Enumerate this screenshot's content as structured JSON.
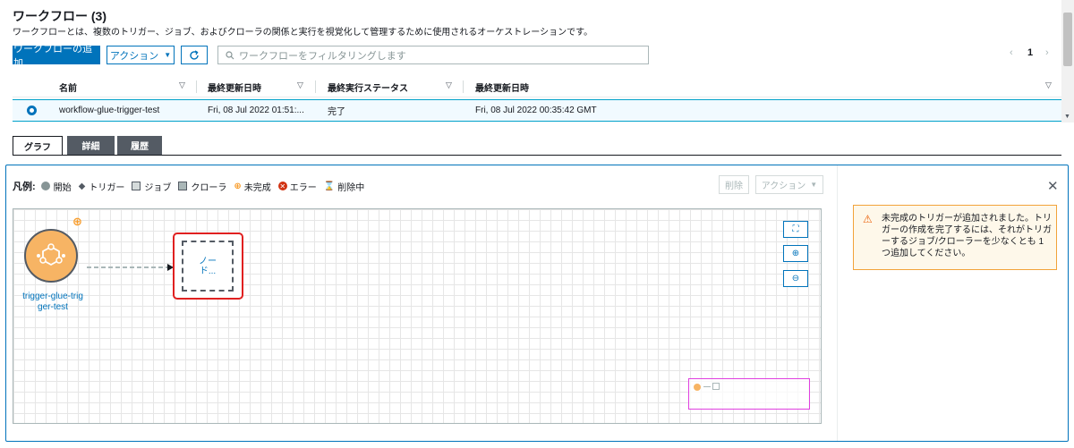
{
  "header": {
    "title": "ワークフロー (3)",
    "description": "ワークフローとは、複数のトリガー、ジョブ、およびクローラの関係と実行を視覚化して管理するために使用されるオーケストレーションです。"
  },
  "toolbar": {
    "add_label": "ワークフローの追加",
    "actions_label": "アクション",
    "search_placeholder": "ワークフローをフィルタリングします",
    "page_number": "1"
  },
  "table": {
    "columns": [
      "名前",
      "最終更新日時",
      "最終実行ステータス",
      "最終更新日時"
    ],
    "rows": [
      {
        "name": "workflow-glue-trigger-test",
        "modified": "Fri, 08 Jul 2022 01:51:...",
        "status": "完了",
        "last_modified": "Fri, 08 Jul 2022 00:35:42 GMT"
      }
    ]
  },
  "tabs": [
    "グラフ",
    "詳細",
    "履歴"
  ],
  "legend": {
    "title": "凡例:",
    "items": [
      "開始",
      "トリガー",
      "ジョブ",
      "クローラ",
      "未完成",
      "エラー",
      "削除中"
    ]
  },
  "graph_actions": {
    "delete_label": "削除",
    "actions_label": "アクション"
  },
  "graph": {
    "trigger_label_line1": "trigger-glue-trig",
    "trigger_label_line2": "ger-test",
    "node_label_line1": "ノー",
    "node_label_line2": "ド..."
  },
  "alert": {
    "message": "未完成のトリガーが追加されました。トリガーの作成を完了するには、それがトリガーするジョブ/クローラーを少なくとも 1 つ追加してください。"
  },
  "colors": {
    "primary": "#0073bb",
    "warning": "#f89c2a",
    "error": "#d13212",
    "selected_node_border": "#e02020",
    "minimap_border": "#e040e0"
  }
}
